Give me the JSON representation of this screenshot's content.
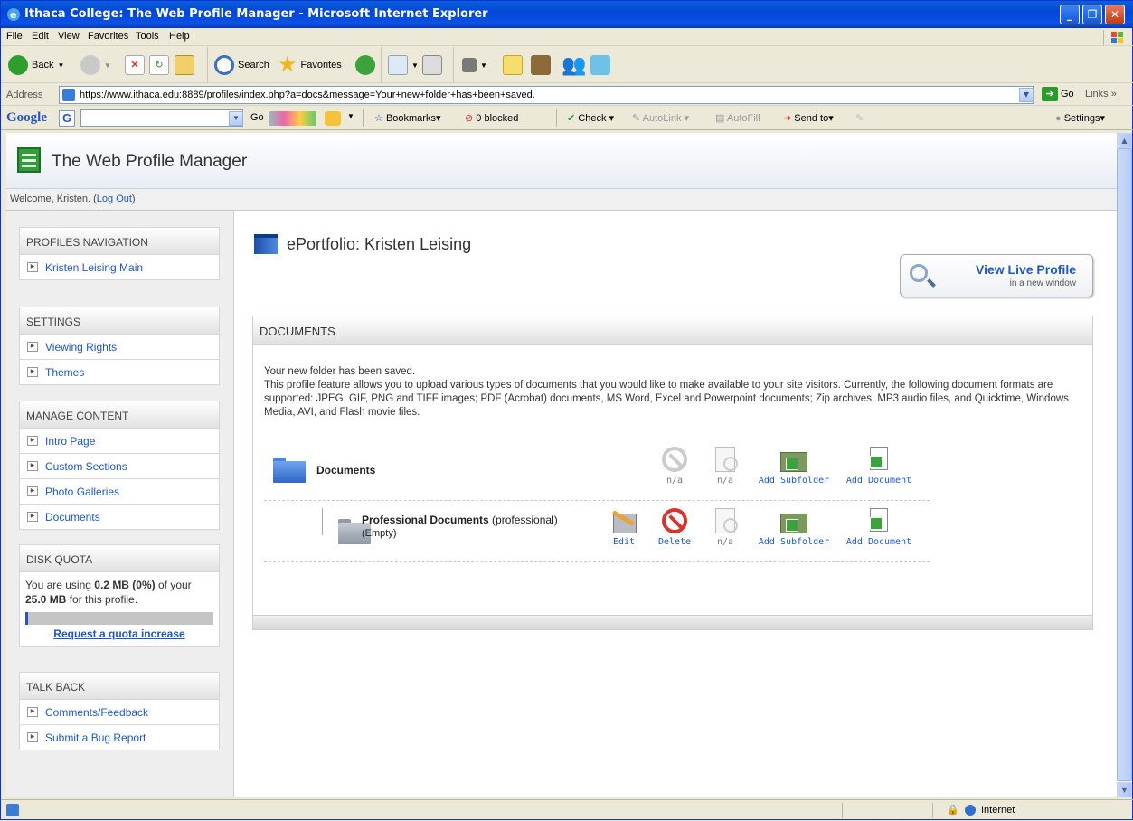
{
  "window": {
    "title": "Ithaca College: The Web Profile Manager - Microsoft Internet Explorer"
  },
  "menu": [
    "File",
    "Edit",
    "View",
    "Favorites",
    "Tools",
    "Help"
  ],
  "toolbar": {
    "back": "Back",
    "search": "Search",
    "favorites": "Favorites"
  },
  "address": {
    "label": "Address",
    "url": "https://www.ithaca.edu:8889/profiles/index.php?a=docs&message=Your+new+folder+has+been+saved.",
    "go": "Go",
    "links": "Links"
  },
  "google": {
    "logo": "Google",
    "go": "Go",
    "bookmarks": "Bookmarks",
    "blocked": "0 blocked",
    "check": "Check",
    "autolink": "AutoLink",
    "autofill": "AutoFill",
    "sendto": "Send to",
    "settings": "Settings"
  },
  "status": {
    "zone": "Internet"
  },
  "page": {
    "header_title": "The Web Profile Manager",
    "welcome_prefix": "Welcome, Kristen. (",
    "logout": "Log Out",
    "welcome_suffix": ")"
  },
  "sidebar": {
    "navigation": {
      "title": "PROFILES NAVIGATION",
      "items": [
        "Kristen Leising Main"
      ]
    },
    "settings": {
      "title": "SETTINGS",
      "items": [
        "Viewing Rights",
        "Themes"
      ]
    },
    "manage": {
      "title": "MANAGE CONTENT",
      "items": [
        "Intro Page",
        "Custom Sections",
        "Photo Galleries",
        "Documents"
      ]
    },
    "quota": {
      "title": "DISK QUOTA",
      "text1": "You are using ",
      "used": "0.2 MB (0%)",
      "text2": " of your ",
      "total": "25.0 MB",
      "text3": " for this profile.",
      "percent": 0.01,
      "link": "Request a quota increase"
    },
    "talkback": {
      "title": "TALK BACK",
      "items": [
        "Comments/Feedback",
        "Submit a Bug Report"
      ]
    }
  },
  "main": {
    "title": "ePortfolio: Kristen Leising",
    "view_live": "View Live Profile",
    "view_live_sub": "in a new window",
    "panel_title": "DOCUMENTS",
    "message": "Your new folder has been saved.",
    "description": "This profile feature allows you to upload various types of documents that you would like to make available to your site visitors. Currently, the following document formats are supported: JPEG, GIF, PNG and TIFF images; PDF (Acrobat) documents, MS Word, Excel and Powerpoint documents; Zip archives, MP3 audio files, and Quicktime, Windows Media, AVI, and Flash movie files.",
    "root_folder": {
      "name": "Documents",
      "actions": [
        "n/a",
        "n/a",
        "Add Subfolder",
        "Add Document"
      ]
    },
    "sub_folder": {
      "name": "Professional Documents",
      "tag": "(professional)",
      "status": "(Empty)",
      "actions": [
        "Edit",
        "Delete",
        "n/a",
        "Add Subfolder",
        "Add Document"
      ]
    }
  },
  "colors": {
    "link": "#1f57c3",
    "titlebar": "#0346d6",
    "delete": "#d9342b"
  }
}
